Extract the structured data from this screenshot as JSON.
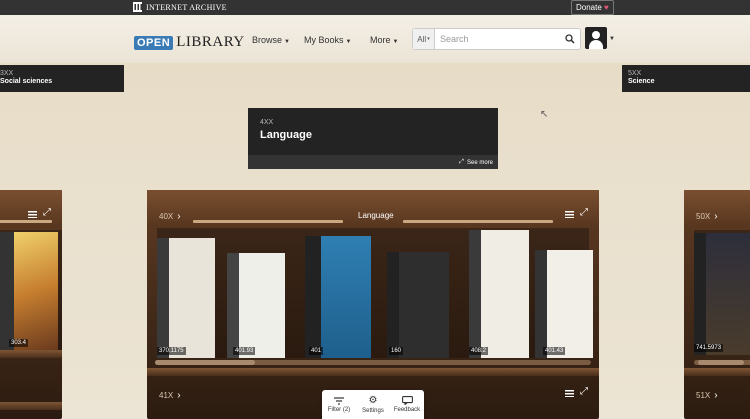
{
  "topbar": {
    "ia_label": "INTERNET ARCHIVE",
    "donate_label": "Donate",
    "heart": "♥"
  },
  "header": {
    "logo_open": "OPEN",
    "logo_library": "LIBRARY",
    "nav": [
      {
        "label": "Browse"
      },
      {
        "label": "My Books"
      },
      {
        "label": "More"
      }
    ],
    "search": {
      "scope": "All",
      "placeholder": "Search"
    }
  },
  "class_cards": {
    "left": {
      "code": "3XX",
      "name": "Social sciences"
    },
    "center": {
      "code": "4XX",
      "name": "Language",
      "see_more": "See more"
    },
    "right": {
      "code": "5XX",
      "name": "Science"
    }
  },
  "shelves": {
    "center": {
      "code": "40X",
      "title": "Language",
      "books": [
        {
          "call_number": "370.1175",
          "color": "#e8e4da",
          "spine": "#3a3a3a"
        },
        {
          "call_number": "401.93",
          "color": "#efefe9",
          "spine": "#444"
        },
        {
          "call_number": "401",
          "color": "#2a74a8",
          "spine": "#222"
        },
        {
          "call_number": "160",
          "color": "#2e2e2e",
          "spine": "#222"
        },
        {
          "call_number": "408.2",
          "color": "#f0ede4",
          "spine": "#3a3a3a"
        },
        {
          "call_number": "401.43",
          "color": "#f1efe8",
          "spine": "#333"
        }
      ],
      "next_code": "41X"
    },
    "left": {
      "books": [
        {
          "call_number": "303.4"
        }
      ]
    },
    "right": {
      "code": "50X",
      "books": [
        {
          "call_number": "741.5973"
        }
      ],
      "next_code": "51X"
    }
  },
  "toolbar": {
    "filter_label": "Filter (2)",
    "settings_label": "Settings",
    "feedback_label": "Feedback"
  }
}
